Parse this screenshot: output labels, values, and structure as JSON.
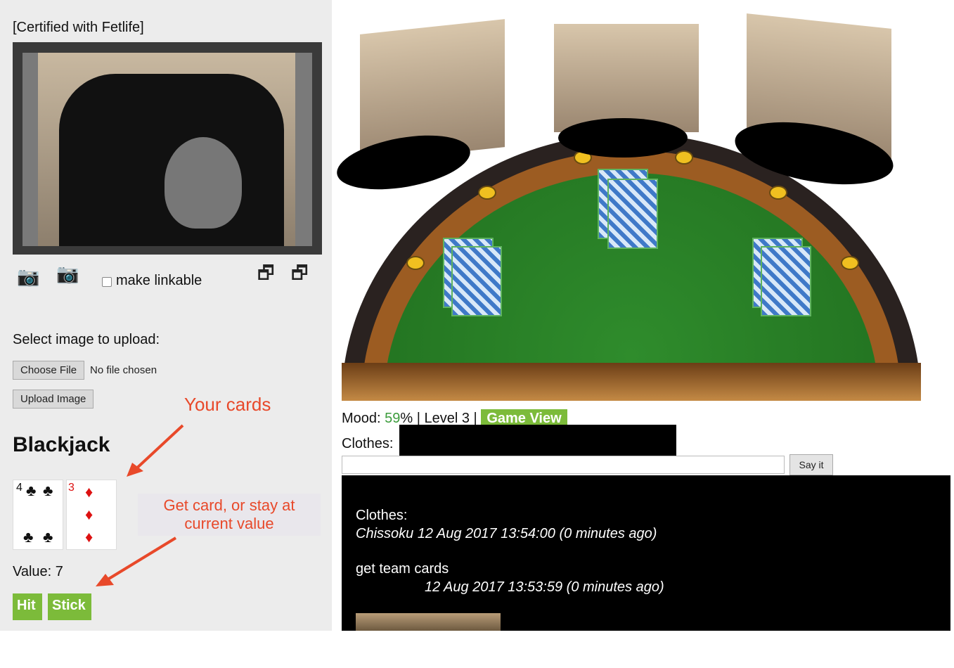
{
  "left": {
    "certified": "[Certified with Fetlife]",
    "make_linkable": "make linkable",
    "select_upload": "Select image to upload:",
    "choose_file": "Choose File",
    "no_file": "No file chosen",
    "upload_image": "Upload Image",
    "annotation_cards": "Your cards",
    "annotation_hit": "Get card, or stay at current value",
    "blackjack_title": "Blackjack",
    "value": "Value: 7",
    "hit": "Hit",
    "stick": "Stick",
    "cards": [
      {
        "rank": "4",
        "suit": "♣",
        "color": "#111"
      },
      {
        "rank": "3",
        "suit": "♦",
        "color": "#d11"
      }
    ]
  },
  "right": {
    "mood_label": "Mood: ",
    "mood_value": "59",
    "mood_suffix": "% | Level 3 |",
    "game_view": "Game View",
    "clothes_label": "Clothes:",
    "say_it": "Say it",
    "chat": [
      {
        "text": "Clothes: ",
        "meta": "Chissoku 12 Aug 2017 13:54:00 (0 minutes ago)"
      },
      {
        "text": "get team cards",
        "meta": "12 Aug 2017 13:53:59 (0 minutes ago)"
      }
    ]
  }
}
